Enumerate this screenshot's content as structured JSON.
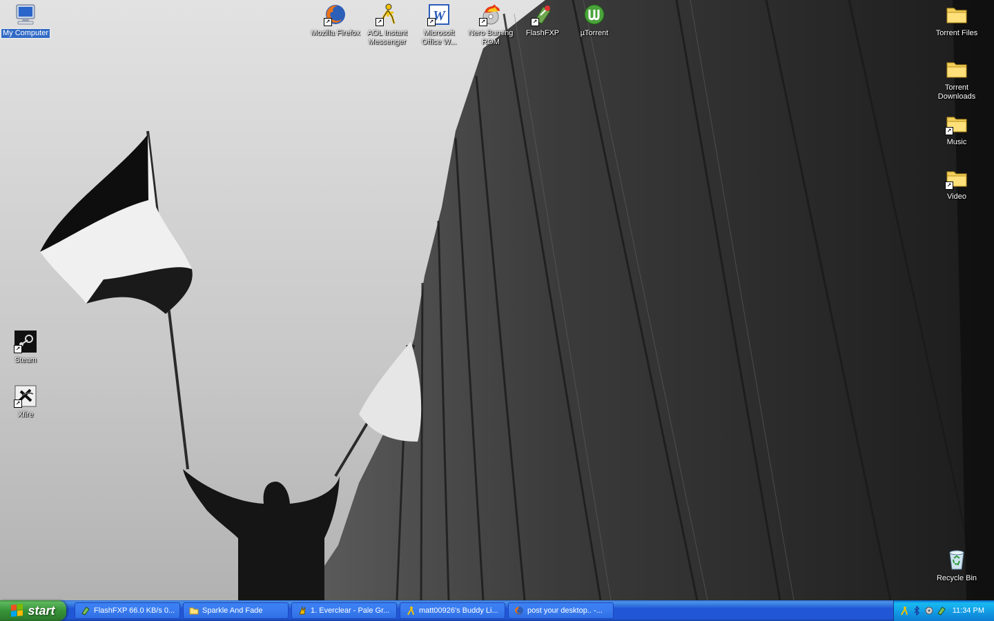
{
  "desktop": {
    "icons_left": [
      {
        "label": "My Computer",
        "icon": "my-computer-icon",
        "selected": true
      },
      {
        "label": "Steam",
        "icon": "steam-icon"
      },
      {
        "label": "Xfire",
        "icon": "xfire-icon"
      }
    ],
    "icons_top": [
      {
        "label": "Mozilla Firefox",
        "icon": "firefox-icon"
      },
      {
        "label": "AOL Instant Messenger",
        "icon": "aim-icon"
      },
      {
        "label": "Microsoft Office W...",
        "icon": "word-icon"
      },
      {
        "label": "Nero Burning ROM",
        "icon": "nero-icon"
      },
      {
        "label": "FlashFXP",
        "icon": "flashfxp-icon"
      },
      {
        "label": "µTorrent",
        "icon": "utorrent-icon"
      }
    ],
    "icons_right": [
      {
        "label": "Torrent Files",
        "icon": "folder-icon"
      },
      {
        "label": "Torrent Downloads",
        "icon": "folder-icon"
      },
      {
        "label": "Music",
        "icon": "folder-icon"
      },
      {
        "label": "Video",
        "icon": "folder-icon"
      },
      {
        "label": "Recycle Bin",
        "icon": "recycle-bin-icon"
      }
    ]
  },
  "taskbar": {
    "start_label": "start",
    "tasks": [
      {
        "label": "FlashFXP 66.0 KB/s 0...",
        "icon": "flashfxp-icon"
      },
      {
        "label": "Sparkle And Fade",
        "icon": "folder-icon"
      },
      {
        "label": "1. Everclear - Pale Gr...",
        "icon": "winamp-icon"
      },
      {
        "label": "matt00926's Buddy Li...",
        "icon": "aim-icon"
      },
      {
        "label": "post your desktop.. -...",
        "icon": "firefox-icon"
      }
    ],
    "clock": "11:34 PM"
  },
  "colors": {
    "taskbar_blue": "#2157d7",
    "start_green": "#379337",
    "tray_blue": "#1297e3"
  }
}
